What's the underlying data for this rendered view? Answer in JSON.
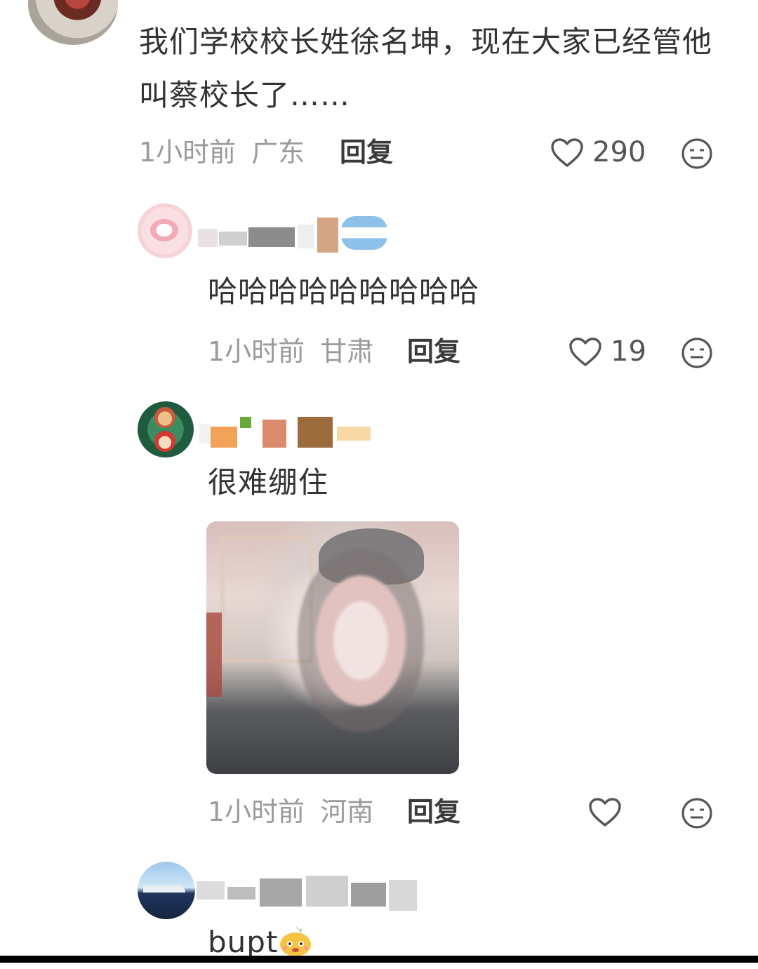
{
  "comments": [
    {
      "text": "我们学校校长姓徐名坤，现在大家已经管他叫蔡校长了……",
      "time": "1小时前",
      "location": "广东",
      "reply_label": "回复",
      "likes": "290"
    },
    {
      "text": "哈哈哈哈哈哈哈哈哈",
      "time": "1小时前",
      "location": "甘肃",
      "reply_label": "回复",
      "likes": "19"
    },
    {
      "text": "很难绷住",
      "time": "1小时前",
      "location": "河南",
      "reply_label": "回复",
      "likes": ""
    },
    {
      "text": "bupt"
    }
  ],
  "colors": {
    "text": "#333333",
    "meta": "#9a9a9a",
    "background": "#ffffff"
  },
  "icons": [
    "heart-icon",
    "neutral-face-icon",
    "emoji-sticker-icon"
  ]
}
